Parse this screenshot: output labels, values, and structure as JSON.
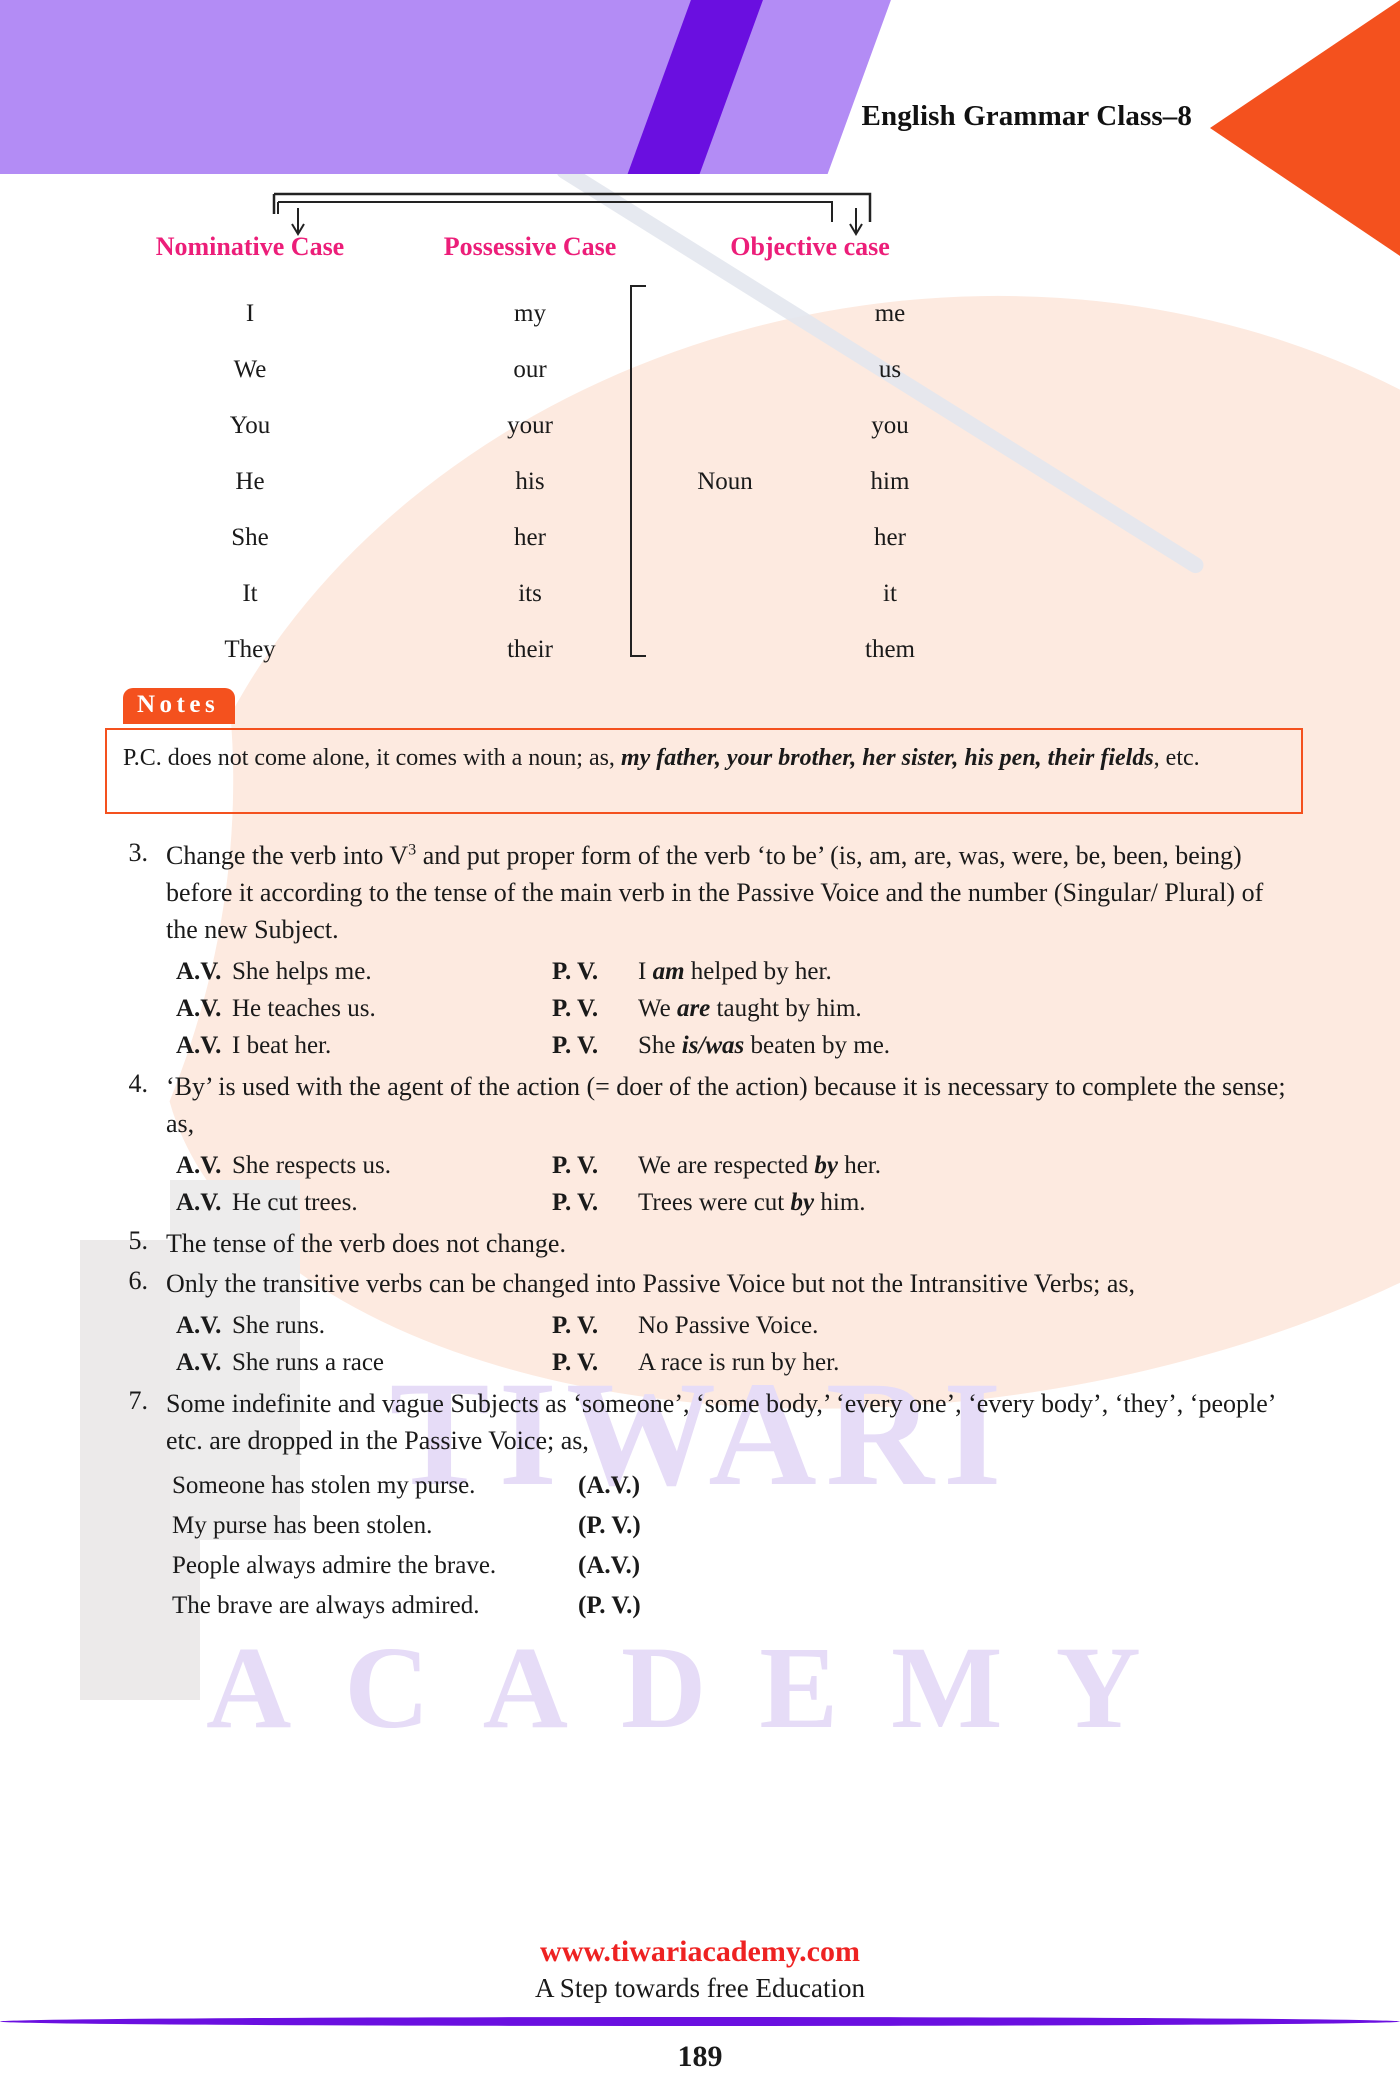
{
  "header": {
    "title": "English Grammar Class–8",
    "band_color": "#b38cf5",
    "stripe_color": "#6a0fe0",
    "arrow_color": "#f4511e"
  },
  "case_table": {
    "accent_color": "#ec1e79",
    "headings": [
      "Nominative Case",
      "Possessive Case",
      "Objective case"
    ],
    "noun_label": "Noun",
    "rows": [
      {
        "nominative": "I",
        "possessive": "my",
        "objective": "me"
      },
      {
        "nominative": "We",
        "possessive": "our",
        "objective": "us"
      },
      {
        "nominative": "You",
        "possessive": "your",
        "objective": "you"
      },
      {
        "nominative": "He",
        "possessive": "his",
        "objective": "him"
      },
      {
        "nominative": "She",
        "possessive": "her",
        "objective": "her"
      },
      {
        "nominative": "It",
        "possessive": "its",
        "objective": "it"
      },
      {
        "nominative": "They",
        "possessive": "their",
        "objective": "them"
      }
    ]
  },
  "notes": {
    "label": "Notes",
    "border_color": "#f4511e",
    "text_plain": "P.C. does not come alone, it comes with a noun; as, ",
    "text_emphasis": "my father, your brother, her sister, his pen, their fields",
    "text_tail": ", etc."
  },
  "items": [
    {
      "number": "3.",
      "text_before_sup": "Change the verb into V",
      "sup": "3",
      "text_after_sup": " and put proper form of the verb ‘to be’ (is, am, are, was, were, be, been, being) before it according to the tense of the main verb in the Passive Voice and the number (Singular/ Plural) of the new Subject."
    },
    {
      "number": "4.",
      "text": "‘By’ is used with the agent of the action (= doer of the action) because it is necessary to complete the sense; as,"
    },
    {
      "number": "5.",
      "text": "The tense of the verb does not change."
    },
    {
      "number": "6.",
      "text": "Only the transitive verbs can be changed into Passive Voice but not the Intransitive Verbs; as,"
    },
    {
      "number": "7.",
      "text": "Some indefinite and vague Subjects as ‘someone’, ‘some body,’ ‘every one’, ‘every body’, ‘they’, ‘people’ etc. are dropped in the Passive Voice; as,"
    }
  ],
  "examples_group_3": {
    "av_label": "A.V.",
    "pv_label": "P. V.",
    "rows": [
      {
        "av": "She helps me.",
        "pv_pre": "I ",
        "pv_em": "am",
        "pv_post": " helped by her."
      },
      {
        "av": "He teaches us.",
        "pv_pre": "We ",
        "pv_em": "are",
        "pv_post": " taught by him."
      },
      {
        "av": "I beat her.",
        "pv_pre": "She ",
        "pv_em": "is/was",
        "pv_post": " beaten by me."
      }
    ]
  },
  "examples_group_4": {
    "av_label": "A.V.",
    "pv_label": "P. V.",
    "rows": [
      {
        "av": "She respects us.",
        "pv_pre": "We are respected ",
        "pv_em": "by",
        "pv_post": " her."
      },
      {
        "av": "He cut trees.",
        "pv_pre": "Trees were cut ",
        "pv_em": "by",
        "pv_post": " him."
      }
    ]
  },
  "examples_group_6": {
    "av_label": "A.V.",
    "pv_label": "P. V.",
    "rows": [
      {
        "av": "She runs.",
        "pv_pre": "No Passive Voice.",
        "pv_em": "",
        "pv_post": ""
      },
      {
        "av": "She runs a race",
        "pv_pre": "A race is run by her.",
        "pv_em": "",
        "pv_post": ""
      }
    ]
  },
  "pairs_group_7": [
    {
      "sentence": "Someone has stolen my purse.",
      "tag": "(A.V.)"
    },
    {
      "sentence": "My purse has been stolen.",
      "tag": "(P. V.)"
    },
    {
      "sentence": "People always admire the brave.",
      "tag": "(A.V.)"
    },
    {
      "sentence": "The brave are always admired.",
      "tag": "(P. V.)"
    }
  ],
  "watermark": {
    "line1": "TIWARI",
    "line2": "ACADEMY",
    "color": "#e6dcf7"
  },
  "footer": {
    "site": "www.tiwariacademy.com",
    "site_color": "#ee2222",
    "tagline": "A Step towards free Education",
    "rule_color": "#6a0fe0",
    "page_number": "189"
  }
}
